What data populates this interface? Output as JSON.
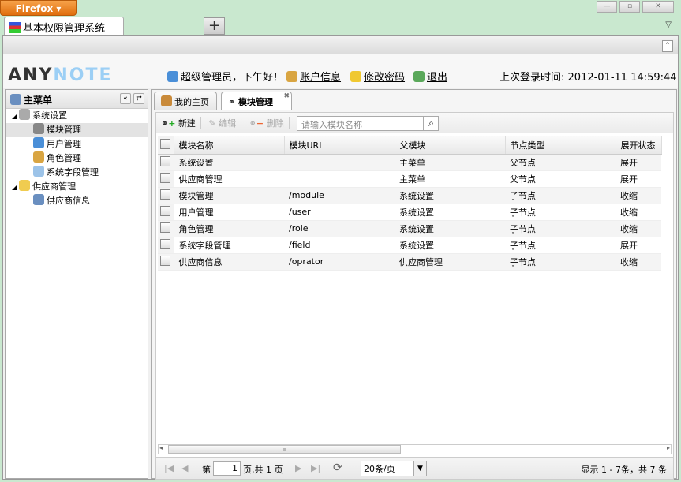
{
  "browser": {
    "menu_label": "Firefox ▾",
    "tab_title": "基本权限管理系统",
    "new_tab": "+",
    "tab_menu": "▽",
    "min": "—",
    "max": "▫",
    "close": "✕",
    "collapse": "⌃"
  },
  "header": {
    "logo_a": "ANY",
    "logo_b": "NOTE",
    "greeting": "超级管理员，下午好！",
    "account": "账户信息",
    "password": "修改密码",
    "logout": "退出",
    "last_login": "上次登录时间: 2012-01-11 14:59:44"
  },
  "sidebar": {
    "title": "主菜单",
    "collapse": "«",
    "refresh": "⇄",
    "items": [
      {
        "label": "系统设置",
        "level": 0
      },
      {
        "label": "模块管理",
        "level": 1,
        "selected": true
      },
      {
        "label": "用户管理",
        "level": 1
      },
      {
        "label": "角色管理",
        "level": 1
      },
      {
        "label": "系统字段管理",
        "level": 1
      },
      {
        "label": "供应商管理",
        "level": 0
      },
      {
        "label": "供应商信息",
        "level": 1
      }
    ]
  },
  "tabs": [
    {
      "label": "我的主页"
    },
    {
      "label": "模块管理",
      "active": true
    }
  ],
  "toolbar": {
    "new": "新建",
    "edit": "编辑",
    "delete": "删除",
    "search_placeholder": "请输入模块名称"
  },
  "grid": {
    "columns": [
      "模块名称",
      "模块URL",
      "父模块",
      "节点类型",
      "展开状态"
    ],
    "rows": [
      [
        "系统设置",
        "",
        "主菜单",
        "父节点",
        "展开"
      ],
      [
        "供应商管理",
        "",
        "主菜单",
        "父节点",
        "展开"
      ],
      [
        "模块管理",
        "/module",
        "系统设置",
        "子节点",
        "收缩"
      ],
      [
        "用户管理",
        "/user",
        "系统设置",
        "子节点",
        "收缩"
      ],
      [
        "角色管理",
        "/role",
        "系统设置",
        "子节点",
        "收缩"
      ],
      [
        "系统字段管理",
        "/field",
        "系统设置",
        "子节点",
        "展开"
      ],
      [
        "供应商信息",
        "/oprator",
        "供应商管理",
        "子节点",
        "收缩"
      ]
    ]
  },
  "pager": {
    "page_prefix": "第",
    "page": "1",
    "page_suffix": "页,共 1 页",
    "page_size": "20条/页",
    "summary": "显示 1 - 7条，共 7 条"
  }
}
